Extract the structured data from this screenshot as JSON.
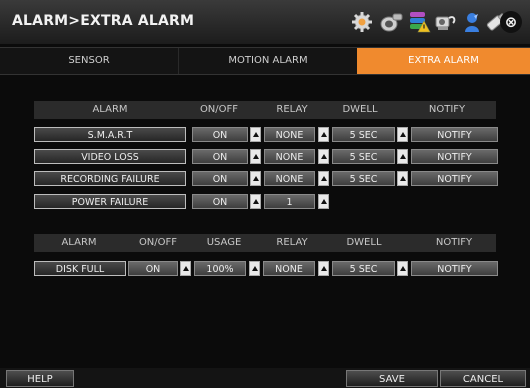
{
  "title": "ALARM>EXTRA ALARM",
  "toolbar_icons": [
    "gear-icon",
    "camera-icon",
    "storage-warning-icon",
    "network-icon",
    "user-icon",
    "usb-icon"
  ],
  "close_label": "⊗",
  "tabs": [
    {
      "label": "SENSOR",
      "active": false
    },
    {
      "label": "MOTION ALARM",
      "active": false
    },
    {
      "label": "EXTRA ALARM",
      "active": true
    }
  ],
  "table1": {
    "headers": {
      "alarm": "ALARM",
      "onoff": "ON/OFF",
      "relay": "RELAY",
      "dwell": "DWELL",
      "notify": "NOTIFY"
    },
    "rows": [
      {
        "name": "S.M.A.R.T",
        "onoff": "ON",
        "relay": "NONE",
        "dwell": "5 SEC",
        "notify": "NOTIFY"
      },
      {
        "name": "VIDEO LOSS",
        "onoff": "ON",
        "relay": "NONE",
        "dwell": "5 SEC",
        "notify": "NOTIFY"
      },
      {
        "name": "RECORDING FAILURE",
        "onoff": "ON",
        "relay": "NONE",
        "dwell": "5 SEC",
        "notify": "NOTIFY"
      },
      {
        "name": "POWER FAILURE",
        "onoff": "ON",
        "relay": "1"
      }
    ]
  },
  "table2": {
    "headers": {
      "alarm": "ALARM",
      "onoff": "ON/OFF",
      "usage": "USAGE",
      "relay": "RELAY",
      "dwell": "DWELL",
      "notify": "NOTIFY"
    },
    "row": {
      "name": "DISK FULL",
      "onoff": "ON",
      "usage": "100%",
      "relay": "NONE",
      "dwell": "5 SEC",
      "notify": "NOTIFY"
    }
  },
  "buttons": {
    "help": "HELP",
    "save": "SAVE",
    "cancel": "CANCEL"
  },
  "colors": {
    "accent": "#f08a2e",
    "background": "#0b0b0b"
  }
}
